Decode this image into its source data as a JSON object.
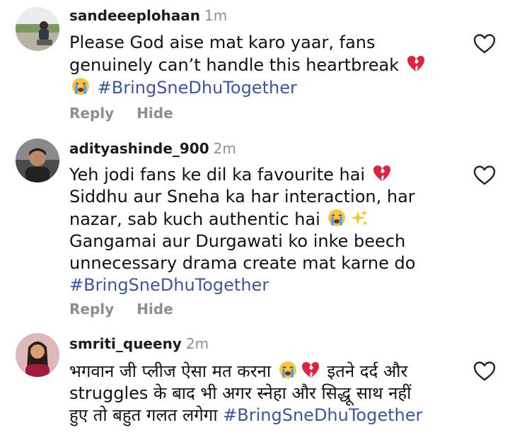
{
  "comments": [
    {
      "username": "sandeeeplohaan",
      "time": "1m",
      "lines": [
        "Please God aise mat karo yaar, fans",
        "genuinely can’t handle this heartbreak",
        ""
      ],
      "hashtag": "#BringSneDhuTogether",
      "reply_label": "Reply",
      "hide_label": "Hide"
    },
    {
      "username": "adityashinde_900",
      "time": "2m",
      "lines": [
        "Yeh jodi fans ke dil ka favourite hai",
        "Siddhu aur Sneha ka har interaction, har",
        "nazar, sab kuch authentic hai",
        "Gangamai aur Durgawati ko inke beech",
        "unnecessary drama create mat karne do"
      ],
      "hashtag": "#BringSneDhuTogether",
      "reply_label": "Reply",
      "hide_label": "Hide"
    },
    {
      "username": "smriti_queeny",
      "time": "2m",
      "lines": [
        "भगवान जी प्लीज ऐसा मत करना",
        "इतने दर्द और",
        "struggles के बाद भी अगर स्नेहा और सिद्धू साथ नहीं",
        "हुए तो बहुत गलत लगेगा"
      ],
      "hashtag": "#BringSneDhuTogether"
    }
  ],
  "icons": {
    "like": "heart-outline-icon",
    "broken_heart": "broken-heart-emoji",
    "crying": "loudly-crying-face-emoji",
    "sparkles": "sparkles-emoji"
  },
  "colors": {
    "hashtag": "#3a55a8",
    "muted": "#8e8e8e",
    "text": "#111111"
  }
}
